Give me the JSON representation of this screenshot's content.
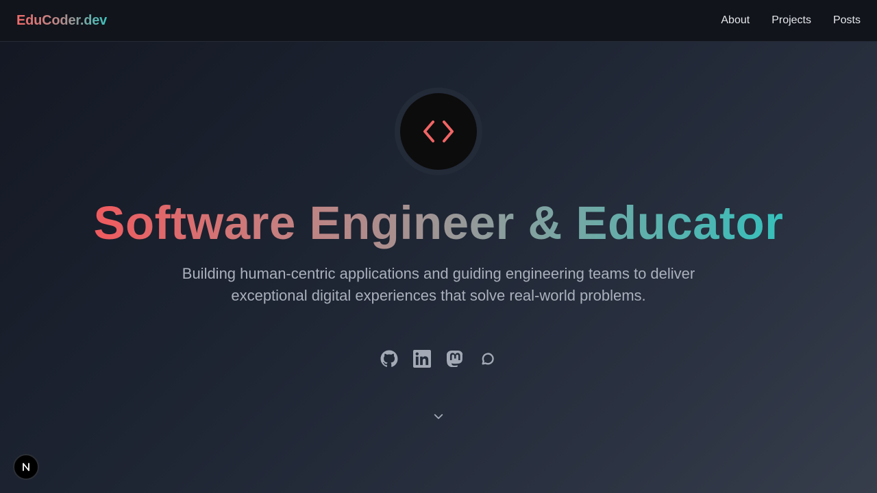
{
  "nav": {
    "brand": "EduCoder.dev",
    "links": [
      {
        "label": "About"
      },
      {
        "label": "Projects"
      },
      {
        "label": "Posts"
      }
    ]
  },
  "hero": {
    "avatar_icon": "code-brackets-icon",
    "title": "Software Engineer & Educator",
    "subtitle": "Building human-centric applications and guiding engineering teams to deliver exceptional digital experiences that solve real-world problems."
  },
  "socials": [
    {
      "icon": "github-icon"
    },
    {
      "icon": "linkedin-icon"
    },
    {
      "icon": "mastodon-icon"
    },
    {
      "icon": "chat-bubble-icon"
    }
  ],
  "scroll_hint_icon": "chevron-down-icon",
  "dev_badge": {
    "icon": "nextjs-icon",
    "letter": "N"
  },
  "colors": {
    "accent_start": "#f05a5e",
    "accent_end": "#35c0bc",
    "avatar_bg": "#0c0c0c",
    "icon_gray": "#a3aab6"
  }
}
